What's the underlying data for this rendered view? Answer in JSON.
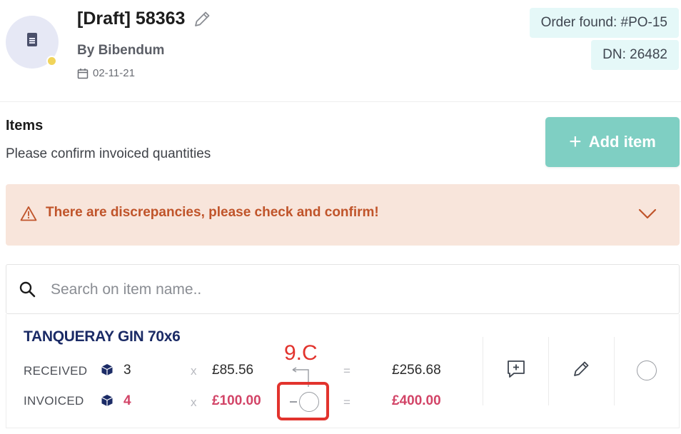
{
  "header": {
    "title": "[Draft] 58363",
    "by": "By Bibendum",
    "date": "02-11-21",
    "order_badge": "Order found: #PO-15",
    "dn_badge": "DN: 26482"
  },
  "items": {
    "title": "Items",
    "subtitle": "Please confirm invoiced quantities",
    "add_button": "Add item",
    "add_plus": "+",
    "alert": "There are discrepancies, please check and confirm!",
    "search_placeholder": "Search on item name.."
  },
  "line_item": {
    "name": "TANQUERAY GIN 70x6",
    "received": {
      "label": "RECEIVED",
      "qty": "3",
      "x": "x",
      "price": "£85.56",
      "eq": "=",
      "total": "£256.68"
    },
    "invoiced": {
      "label": "INVOICED",
      "qty": "4",
      "x": "x",
      "price": "£100.00",
      "eq": "=",
      "total": "£400.00"
    }
  },
  "annotation": {
    "label": "9.C"
  },
  "colors": {
    "accent": "#7fcfc3",
    "alert_bg": "#f8e5db",
    "alert_text": "#c0542a",
    "discrepancy": "#d24467",
    "badge_bg": "#e5f8f8",
    "annotation": "#e2332d"
  },
  "icons": [
    "document-icon",
    "pencil-icon",
    "calendar-icon",
    "warning-icon",
    "chevron-down-icon",
    "search-icon",
    "box-icon",
    "comment-plus-icon",
    "edit-icon",
    "radio-icon"
  ]
}
